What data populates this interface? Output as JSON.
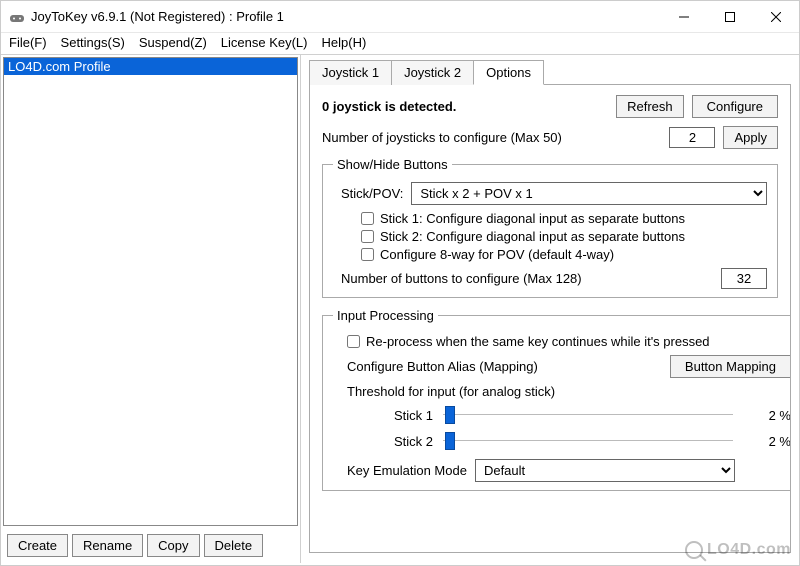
{
  "window": {
    "title": "JoyToKey v6.9.1 (Not Registered) : Profile 1"
  },
  "menu": {
    "file": "File(F)",
    "settings": "Settings(S)",
    "suspend": "Suspend(Z)",
    "license": "License Key(L)",
    "help": "Help(H)"
  },
  "left": {
    "profile_selected": "LO4D.com Profile",
    "buttons": {
      "create": "Create",
      "rename": "Rename",
      "copy": "Copy",
      "delete": "Delete"
    }
  },
  "tabs": {
    "joy1": "Joystick 1",
    "joy2": "Joystick 2",
    "options": "Options"
  },
  "options": {
    "status": "0 joystick is detected.",
    "refresh": "Refresh",
    "configure": "Configure",
    "num_joystick_label": "Number of joysticks to configure (Max 50)",
    "num_joystick_value": "2",
    "apply": "Apply",
    "show_hide": {
      "legend": "Show/Hide Buttons",
      "stickpov_label": "Stick/POV:",
      "stickpov_value": "Stick x 2 + POV x 1",
      "chk1": "Stick 1: Configure diagonal input as separate buttons",
      "chk2": "Stick 2: Configure diagonal input as separate buttons",
      "chk3": "Configure 8-way for POV (default 4-way)",
      "num_buttons_label": "Number of buttons to configure (Max 128)",
      "num_buttons_value": "32"
    },
    "input_proc": {
      "legend": "Input Processing",
      "reprocess": "Re-process when the same key continues while it's pressed",
      "alias_label": "Configure Button Alias (Mapping)",
      "alias_btn": "Button Mapping",
      "threshold_label": "Threshold for input (for analog stick)",
      "stick1_label": "Stick 1",
      "stick1_pct": "2 %",
      "stick2_label": "Stick 2",
      "stick2_pct": "2 %",
      "emu_label": "Key Emulation Mode",
      "emu_value": "Default"
    }
  },
  "watermark": "LO4D.com"
}
